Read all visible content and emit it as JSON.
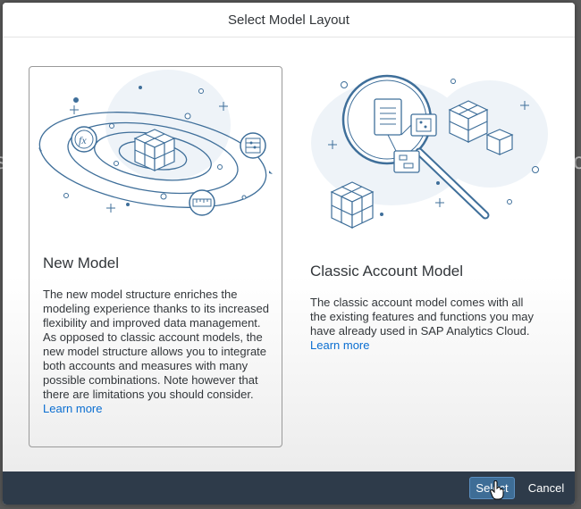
{
  "dialog": {
    "title": "Select Model Layout"
  },
  "cards": {
    "new_model": {
      "title": "New Model",
      "description": "The new model structure enriches the modeling experience thanks to its increased flexibility and improved data management. As opposed to classic account models, the new model structure allows you to integrate both accounts and measures with many possible combinations. Note however that there are limitations you should consider.",
      "learn_more": "Learn more",
      "selected": true,
      "icons": [
        "fx-icon",
        "cube-icon",
        "abacus-icon",
        "ruler-icon"
      ]
    },
    "classic_model": {
      "title": "Classic Account Model",
      "description": "The classic account model comes with all the existing features and functions you may have already used in SAP Analytics Cloud.",
      "learn_more": "Learn more",
      "selected": false,
      "icons": [
        "magnifier-icon",
        "document-icon",
        "abacus-icon",
        "flowchart-icon",
        "cube-icon"
      ]
    }
  },
  "footer": {
    "select_label": "Select",
    "cancel_label": "Cancel"
  },
  "colors": {
    "accent": "#0a6ed1",
    "footer_bg": "#2e3b4a",
    "select_button": "#3e6d96",
    "illustration_blue": "#3f6f9a"
  }
}
